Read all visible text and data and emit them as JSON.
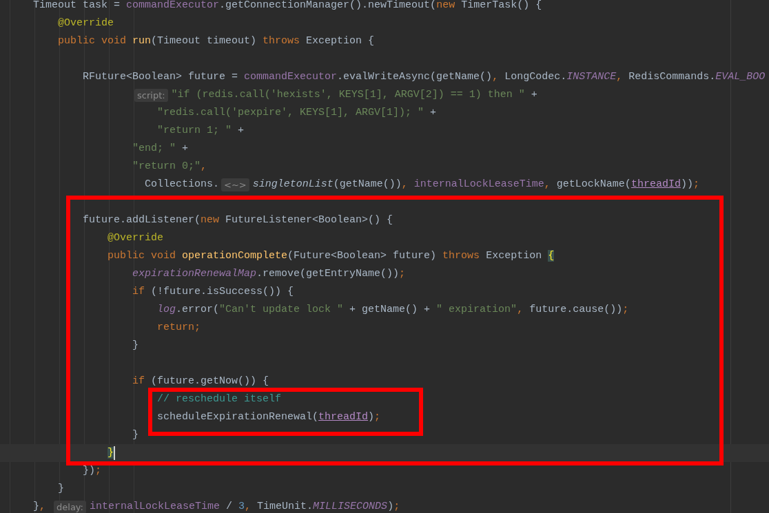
{
  "editor": {
    "lines": [
      {
        "kind": "line",
        "current": false,
        "tokens": [
          {
            "kind": "plain",
            "text": "Timeout task = "
          },
          {
            "kind": "field",
            "text": "commandExecutor"
          },
          {
            "kind": "plain",
            "text": ".getConnectionManager().newTimeout("
          },
          {
            "kind": "kw",
            "text": "new"
          },
          {
            "kind": "plain",
            "text": " TimerTask() {"
          }
        ],
        "children": [
          {
            "kind": "line",
            "current": false,
            "tokens": [
              {
                "kind": "ann",
                "text": "@Override"
              }
            ]
          },
          {
            "kind": "line",
            "current": false,
            "tokens": [
              {
                "kind": "kw",
                "text": "public void "
              },
              {
                "kind": "decl",
                "text": "run"
              },
              {
                "kind": "plain",
                "text": "(Timeout timeout) "
              },
              {
                "kind": "kw",
                "text": "throws"
              },
              {
                "kind": "plain",
                "text": " Exception {"
              }
            ],
            "children": [
              {
                "kind": "line",
                "current": false
              },
              {
                "kind": "line",
                "current": false,
                "tokens": [
                  {
                    "kind": "plain",
                    "text": "RFuture<Boolean> future = "
                  },
                  {
                    "kind": "field",
                    "text": "commandExecutor"
                  },
                  {
                    "kind": "plain",
                    "text": ".evalWriteAsync(getName()"
                  },
                  {
                    "kind": "punct",
                    "text": ", "
                  },
                  {
                    "kind": "plain",
                    "text": "LongCodec."
                  },
                  {
                    "kind": "static",
                    "text": "INSTANCE"
                  },
                  {
                    "kind": "punct",
                    "text": ", "
                  },
                  {
                    "kind": "plain",
                    "text": "RedisCommands."
                  },
                  {
                    "kind": "static",
                    "text": "EVAL_BOO"
                  }
                ],
                "children": [
                  {
                    "kind": "wrap",
                    "current": false,
                    "tokens": [
                      {
                        "kind": "hint",
                        "text": "script:"
                      },
                      {
                        "kind": "str",
                        "text": "\"if (redis.call('hexists', KEYS[1], ARGV[2]) == 1) then \""
                      },
                      {
                        "kind": "plain",
                        "text": " +"
                      }
                    ]
                  },
                  {
                    "kind": "wrap-deep",
                    "current": false,
                    "tokens": [
                      {
                        "kind": "str",
                        "text": "\"redis.call('pexpire', KEYS[1], ARGV[1]); \""
                      },
                      {
                        "kind": "plain",
                        "text": " +"
                      }
                    ]
                  },
                  {
                    "kind": "wrap-deep",
                    "current": false,
                    "tokens": [
                      {
                        "kind": "str",
                        "text": "\"return 1; \""
                      },
                      {
                        "kind": "plain",
                        "text": " +"
                      }
                    ]
                  },
                  {
                    "kind": "wrap",
                    "current": false,
                    "tokens": [
                      {
                        "kind": "str",
                        "text": "\"end; \""
                      },
                      {
                        "kind": "plain",
                        "text": " +"
                      }
                    ]
                  },
                  {
                    "kind": "wrap",
                    "current": false,
                    "tokens": [
                      {
                        "kind": "str",
                        "text": "\"return 0;\""
                      },
                      {
                        "kind": "punct",
                        "text": ","
                      }
                    ]
                  },
                  {
                    "kind": "wrap-shift",
                    "current": false,
                    "tokens": [
                      {
                        "kind": "plain",
                        "text": "Collections."
                      },
                      {
                        "kind": "hint",
                        "text": "<~>"
                      },
                      {
                        "kind": "italic",
                        "text": "singletonList"
                      },
                      {
                        "kind": "plain",
                        "text": "(getName())"
                      },
                      {
                        "kind": "punct",
                        "text": ", "
                      },
                      {
                        "kind": "field",
                        "text": "internalLockLeaseTime"
                      },
                      {
                        "kind": "punct",
                        "text": ", "
                      },
                      {
                        "kind": "plain",
                        "text": "getLockName("
                      },
                      {
                        "kind": "param",
                        "text": "threadId"
                      },
                      {
                        "kind": "plain",
                        "text": "))"
                      },
                      {
                        "kind": "punct",
                        "text": ";"
                      }
                    ]
                  }
                ]
              },
              {
                "kind": "frame",
                "lines": [
                  {
                    "kind": "line",
                    "current": false
                  },
                  {
                    "kind": "line",
                    "current": false,
                    "tokens": [
                      {
                        "kind": "plain",
                        "text": "future.addListener("
                      },
                      {
                        "kind": "kw",
                        "text": "new"
                      },
                      {
                        "kind": "plain",
                        "text": " FutureListener<Boolean>() {"
                      }
                    ],
                    "children": [
                      {
                        "kind": "line",
                        "current": false,
                        "tokens": [
                          {
                            "kind": "ann",
                            "text": "@Override"
                          }
                        ]
                      },
                      {
                        "kind": "line",
                        "current": false,
                        "tokens": [
                          {
                            "kind": "kw",
                            "text": "public void "
                          },
                          {
                            "kind": "decl",
                            "text": "operationComplete"
                          },
                          {
                            "kind": "plain",
                            "text": "(Future<Boolean> future) "
                          },
                          {
                            "kind": "kw",
                            "text": "throws"
                          },
                          {
                            "kind": "plain",
                            "text": " Exception "
                          },
                          {
                            "kind": "brace",
                            "text": "{"
                          }
                        ],
                        "children": [
                          {
                            "kind": "line",
                            "current": false,
                            "tokens": [
                              {
                                "kind": "static",
                                "text": "expirationRenewalMap"
                              },
                              {
                                "kind": "plain",
                                "text": ".remove(getEntryName())"
                              },
                              {
                                "kind": "punct",
                                "text": ";"
                              }
                            ]
                          },
                          {
                            "kind": "line",
                            "current": false,
                            "tokens": [
                              {
                                "kind": "kw",
                                "text": "if"
                              },
                              {
                                "kind": "plain",
                                "text": " (!future.isSuccess()) {"
                              }
                            ],
                            "children": [
                              {
                                "kind": "line",
                                "current": false,
                                "tokens": [
                                  {
                                    "kind": "static",
                                    "text": "log"
                                  },
                                  {
                                    "kind": "plain",
                                    "text": ".error("
                                  },
                                  {
                                    "kind": "str",
                                    "text": "\"Can't update lock \""
                                  },
                                  {
                                    "kind": "plain",
                                    "text": " + getName() + "
                                  },
                                  {
                                    "kind": "str",
                                    "text": "\" expiration\""
                                  },
                                  {
                                    "kind": "punct",
                                    "text": ", "
                                  },
                                  {
                                    "kind": "plain",
                                    "text": "future.cause())"
                                  },
                                  {
                                    "kind": "punct",
                                    "text": ";"
                                  }
                                ]
                              },
                              {
                                "kind": "line",
                                "current": false,
                                "tokens": [
                                  {
                                    "kind": "kw",
                                    "text": "return;"
                                  }
                                ]
                              }
                            ]
                          },
                          {
                            "kind": "line",
                            "current": false,
                            "tokens": [
                              {
                                "kind": "plain",
                                "text": "}"
                              }
                            ]
                          },
                          {
                            "kind": "line",
                            "current": false
                          },
                          {
                            "kind": "line",
                            "current": false,
                            "tokens": [
                              {
                                "kind": "kw",
                                "text": "if"
                              },
                              {
                                "kind": "plain",
                                "text": " (future.getNow()) {"
                              }
                            ],
                            "children": [
                              {
                                "kind": "frame",
                                "lines": [
                                  {
                                    "kind": "line",
                                    "current": false,
                                    "tokens": [
                                      {
                                        "kind": "comment",
                                        "text": "// reschedule itself"
                                      }
                                    ]
                                  },
                                  {
                                    "kind": "line",
                                    "current": false,
                                    "tokens": [
                                      {
                                        "kind": "plain",
                                        "text": "scheduleExpirationRenewal("
                                      },
                                      {
                                        "kind": "param",
                                        "text": "threadId"
                                      },
                                      {
                                        "kind": "plain",
                                        "text": ")"
                                      },
                                      {
                                        "kind": "punct",
                                        "text": ";"
                                      }
                                    ]
                                  }
                                ]
                              }
                            ]
                          },
                          {
                            "kind": "line",
                            "current": false,
                            "tokens": [
                              {
                                "kind": "plain",
                                "text": "}"
                              }
                            ]
                          }
                        ]
                      },
                      {
                        "kind": "line",
                        "current": true,
                        "tokens": [
                          {
                            "kind": "brace",
                            "text": "}"
                          }
                        ]
                      }
                    ]
                  }
                ]
              },
              {
                "kind": "line",
                "current": false,
                "tokens": [
                  {
                    "kind": "plain",
                    "text": "})"
                  },
                  {
                    "kind": "punct",
                    "text": ";"
                  }
                ]
              }
            ]
          },
          {
            "kind": "line",
            "current": false,
            "tokens": [
              {
                "kind": "plain",
                "text": "}"
              }
            ]
          }
        ]
      },
      {
        "kind": "line",
        "current": false,
        "tokens": [
          {
            "kind": "plain",
            "text": "}"
          },
          {
            "kind": "punct",
            "text": ", "
          },
          {
            "kind": "hint",
            "text": "delay:"
          },
          {
            "kind": "field",
            "text": "internalLockLeaseTime"
          },
          {
            "kind": "plain",
            "text": " / "
          },
          {
            "kind": "num",
            "text": "3"
          },
          {
            "kind": "punct",
            "text": ", "
          },
          {
            "kind": "plain",
            "text": "TimeUnit."
          },
          {
            "kind": "static",
            "text": "MILLISECONDS"
          },
          {
            "kind": "plain",
            "text": ")"
          },
          {
            "kind": "punct",
            "text": ";"
          }
        ]
      }
    ]
  }
}
